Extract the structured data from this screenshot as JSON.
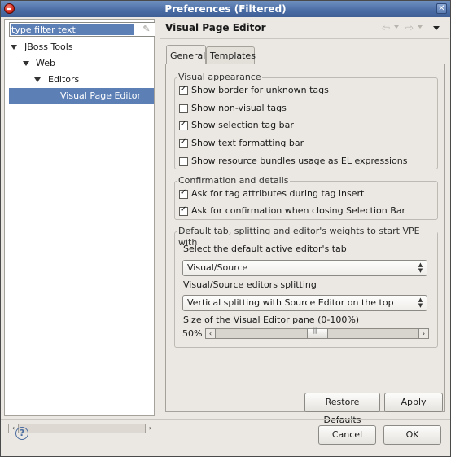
{
  "window": {
    "title": "Preferences (Filtered)"
  },
  "filter": {
    "placeholder": "type filter text"
  },
  "tree": {
    "items": [
      {
        "label": "JBoss Tools"
      },
      {
        "label": "Web"
      },
      {
        "label": "Editors"
      },
      {
        "label": "Visual Page Editor"
      }
    ]
  },
  "page": {
    "title": "Visual Page Editor"
  },
  "tabs": [
    {
      "label": "General"
    },
    {
      "label": "Templates"
    }
  ],
  "appearance": {
    "title": "Visual appearance",
    "options": [
      {
        "label": "Show border for unknown tags",
        "checked": true
      },
      {
        "label": "Show non-visual tags",
        "checked": false
      },
      {
        "label": "Show selection tag bar",
        "checked": true
      },
      {
        "label": "Show text formatting bar",
        "checked": true
      },
      {
        "label": "Show resource bundles usage as EL expressions",
        "checked": false
      }
    ]
  },
  "confirmation": {
    "title": "Confirmation and details",
    "options": [
      {
        "label": "Ask for tag attributes during tag insert",
        "checked": true
      },
      {
        "label": "Ask for confirmation when closing Selection Bar",
        "checked": true
      }
    ]
  },
  "defaults": {
    "title": "Default tab, splitting and editor's weights to start VPE with",
    "tab_label": "Select the default active editor's tab",
    "tab_value": "Visual/Source",
    "splitting_label": "Visual/Source editors splitting",
    "splitting_value": "Vertical splitting with Source Editor on the top",
    "size_label": "Size of the Visual Editor pane (0-100%)",
    "size_value": "50%",
    "size_fraction": 0.5
  },
  "buttons": {
    "restore_defaults": "Restore Defaults",
    "apply": "Apply",
    "cancel": "Cancel",
    "ok": "OK"
  },
  "icons": {
    "title_icon": "app-icon",
    "close": "close-icon",
    "help": "help-icon"
  },
  "colors": {
    "title_bar": "#4c6ea6",
    "selection": "#5c7fb6"
  }
}
